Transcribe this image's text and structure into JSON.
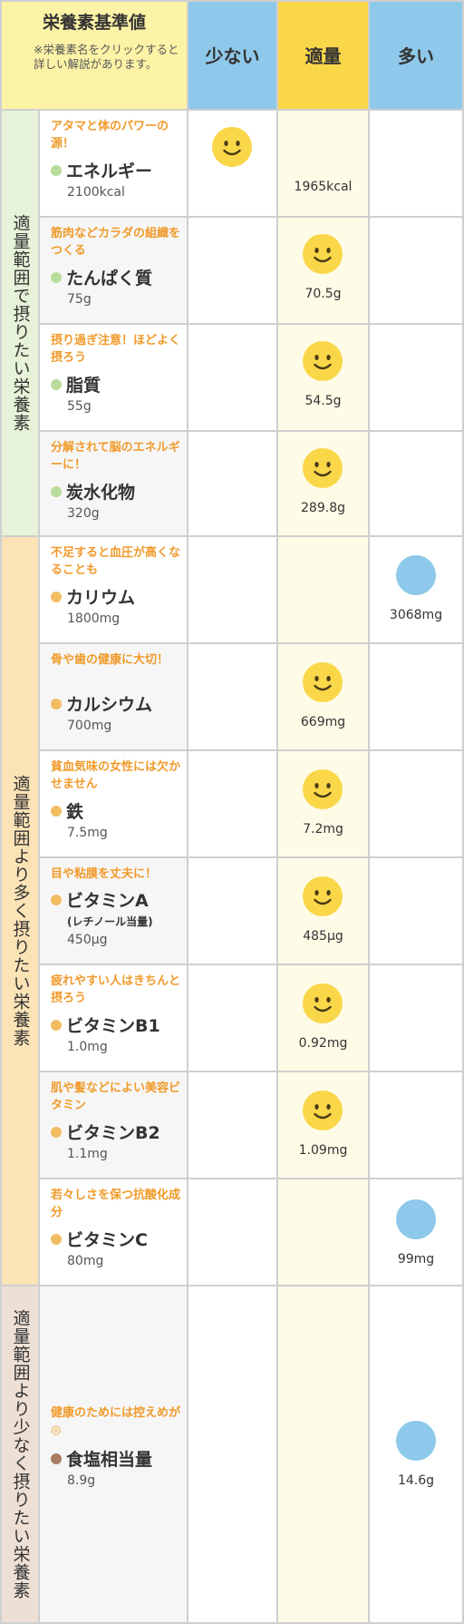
{
  "header": {
    "title": "栄養素基準値",
    "note": "※栄養素名をクリックすると詳しい解説があります。",
    "col_low": "少ない",
    "col_ok": "適量",
    "col_high": "多い"
  },
  "groups": [
    {
      "label": "適量範囲で摂りたい栄養素"
    },
    {
      "label": "適量範囲より多く摂りたい栄養素"
    },
    {
      "label": "適量範囲より少なく摂りたい栄養素"
    }
  ],
  "nutrients": [
    {
      "tag": "アタマと体のパワーの源！",
      "name": "エネルギー",
      "amount": "2100kcal",
      "level": "適量",
      "value": "1965kcal"
    },
    {
      "tag": "筋肉などカラダの組織をつくる",
      "name": "たんぱく質",
      "amount": "75g",
      "level": "適量",
      "value": "70.5g"
    },
    {
      "tag": "摂り過ぎ注意！ほどよく摂ろう",
      "name": "脂質",
      "amount": "55g",
      "level": "適量",
      "value": "54.5g"
    },
    {
      "tag": "分解されて脳のエネルギーに！",
      "name": "炭水化物",
      "amount": "320g",
      "level": "適量",
      "value": "289.8g"
    },
    {
      "tag": "不足すると血圧が高くなることも",
      "name": "カリウム",
      "amount": "1800mg",
      "level": "多い",
      "value": "3068mg"
    },
    {
      "tag": "骨や歯の健康に大切！",
      "name": "カルシウム",
      "amount": "700mg",
      "level": "適量",
      "value": "669mg"
    },
    {
      "tag": "貧血気味の女性には欠かせません",
      "name": "鉄",
      "amount": "7.5mg",
      "level": "適量",
      "value": "7.2mg"
    },
    {
      "tag": "目や粘膜を丈夫に！",
      "name": "ビタミンA",
      "sub": "(レチノール当量)",
      "amount": "450μg",
      "level": "適量",
      "value": "485μg"
    },
    {
      "tag": "疲れやすい人はきちんと摂ろう",
      "name": "ビタミンB1",
      "amount": "1.0mg",
      "level": "適量",
      "value": "0.92mg"
    },
    {
      "tag": "肌や髪などによい美容ビタミン",
      "name": "ビタミンB2",
      "amount": "1.1mg",
      "level": "適量",
      "value": "1.09mg"
    },
    {
      "tag": "若々しさを保つ抗酸化成分",
      "name": "ビタミンC",
      "amount": "80mg",
      "level": "多い",
      "value": "99mg"
    },
    {
      "tag": "健康のためには控えめが◎",
      "name": "食塩相当量",
      "amount": "8.9g",
      "level": "多い",
      "value": "14.6g"
    }
  ],
  "icons": {
    "ok": "smiley-face-icon",
    "high": "blue-circle-icon"
  },
  "colors": {
    "ok": "#fad749",
    "high": "#8ec8ea",
    "tag": "#f09a2a"
  }
}
